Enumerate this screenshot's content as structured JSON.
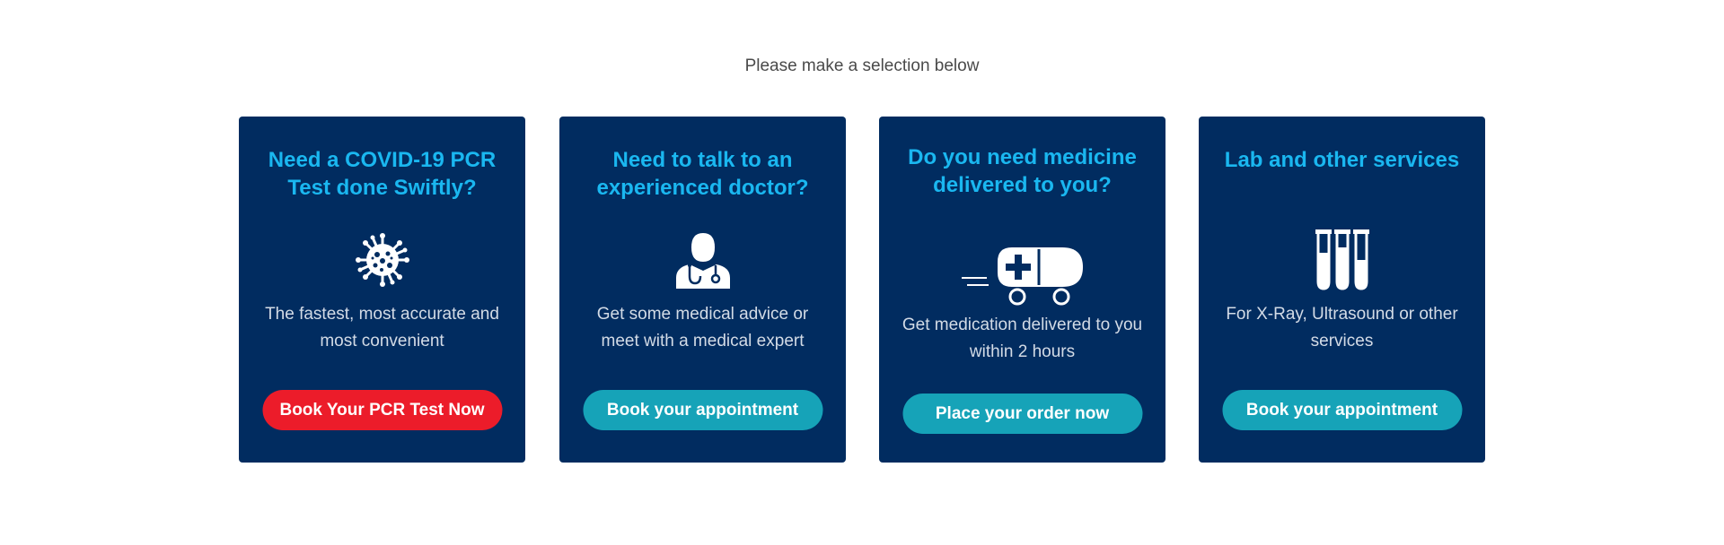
{
  "intro": {
    "text": "Please make a selection below"
  },
  "cards": [
    {
      "title": "Need a COVID-19 PCR Test done Swiftly?",
      "icon": "virus-icon",
      "description": "The fastest, most accurate and most convenient",
      "button_label": "Book Your PCR Test Now",
      "button_color": "#ec1c2a"
    },
    {
      "title": "Need to talk to an experienced doctor?",
      "icon": "doctor-icon",
      "description": "Get some medical advice or meet with a medical expert",
      "button_label": "Book your appointment",
      "button_color": "#16a3b8"
    },
    {
      "title": "Do you need medicine delivered to you?",
      "icon": "medicine-delivery-icon",
      "description": "Get medication delivered to you within 2 hours",
      "button_label": "Place your order now",
      "button_color": "#16a3b8"
    },
    {
      "title": "Lab and other services",
      "icon": "test-tubes-icon",
      "description": "For X-Ray, Ultrasound or other services",
      "button_label": "Book your appointment",
      "button_color": "#16a3b8"
    }
  ],
  "colors": {
    "card_background": "#012c60",
    "title_accent": "#1ab7f0",
    "primary_red": "#ec1c2a",
    "primary_teal": "#16a3b8"
  }
}
